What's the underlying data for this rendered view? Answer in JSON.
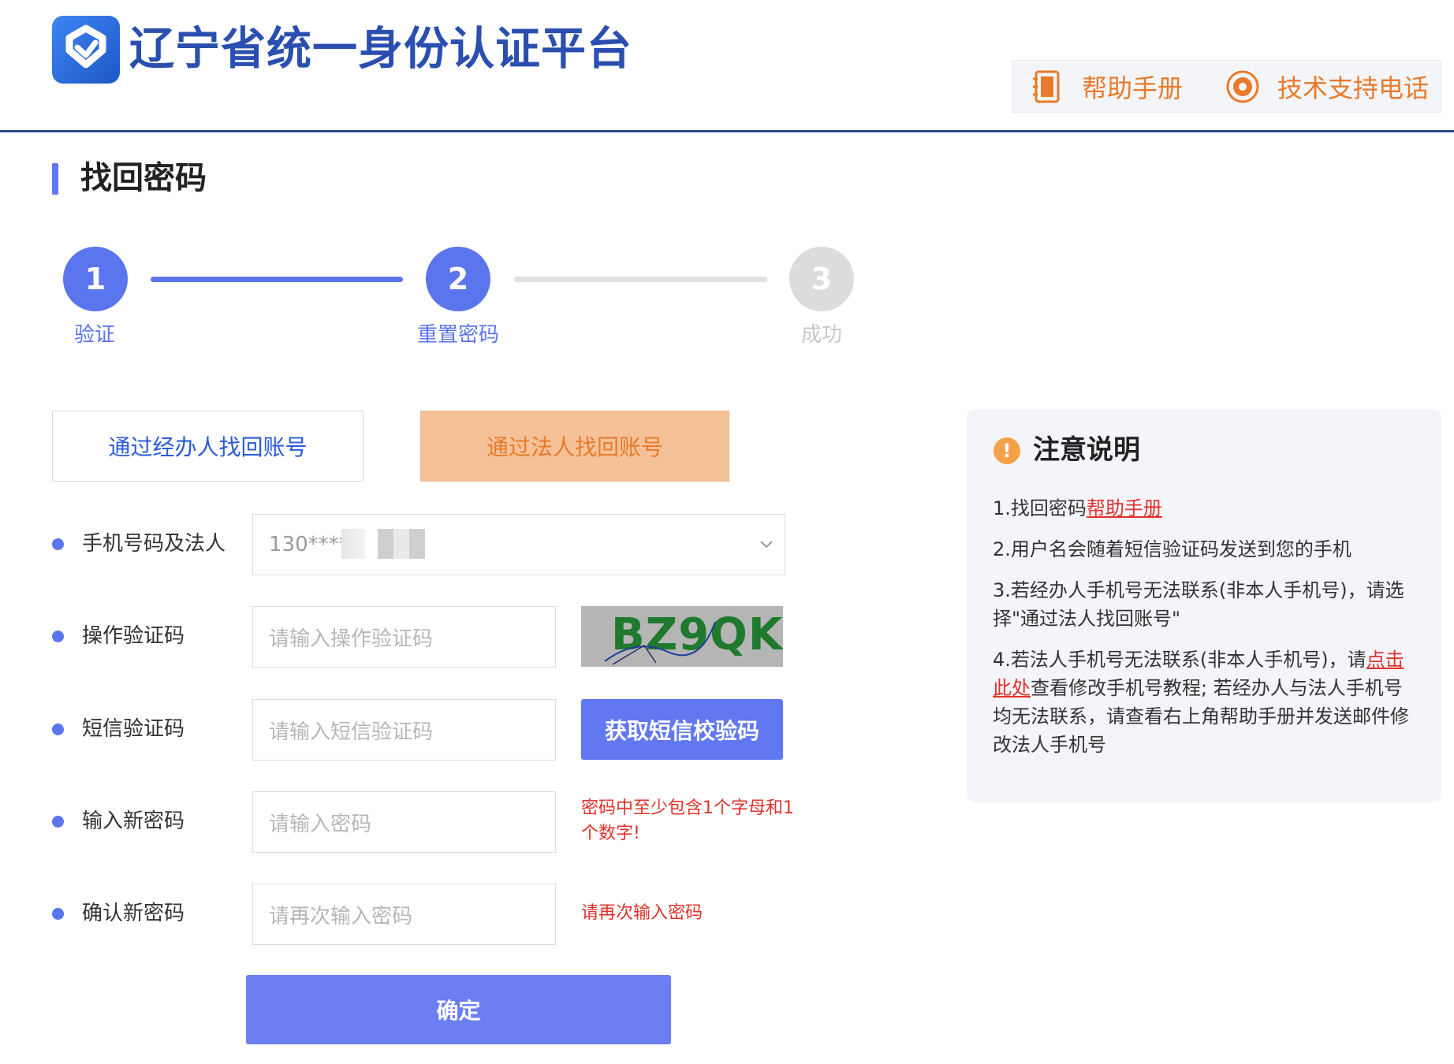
{
  "header": {
    "site_title": "辽宁省统一身份认证平台",
    "help_manual": "帮助手册",
    "support_phone": "技术支持电话",
    "accent": "#2a4fb0",
    "help_color": "#e87a2a"
  },
  "page": {
    "section_title": "找回密码"
  },
  "steps": [
    {
      "number": "1",
      "label": "验证",
      "state": "done"
    },
    {
      "number": "2",
      "label": "重置密码",
      "state": "active"
    },
    {
      "number": "3",
      "label": "成功",
      "state": "todo"
    }
  ],
  "tabs": {
    "agent": "通过经办人找回账号",
    "legal": "通过法人找回账号"
  },
  "form": {
    "phone_label": "手机号码及法人",
    "phone_value": "130****",
    "op_code_label": "操作验证码",
    "op_code_placeholder": "请输入操作验证码",
    "captcha_text": "BZ9QK",
    "sms_label": "短信验证码",
    "sms_placeholder": "请输入短信验证码",
    "sms_button": "获取短信校验码",
    "new_pwd_label": "输入新密码",
    "new_pwd_placeholder": "请输入密码",
    "new_pwd_hint": "密码中至少包含1个字母和1个数字!",
    "confirm_pwd_label": "确认新密码",
    "confirm_pwd_placeholder": "请再次输入密码",
    "confirm_pwd_hint": "请再次输入密码",
    "submit": "确定"
  },
  "notice": {
    "title": "注意说明",
    "item1_prefix": "1.找回密码",
    "item1_link": "帮助手册",
    "item2": "2.用户名会随着短信验证码发送到您的手机",
    "item3": "3.若经办人手机号无法联系(非本人手机号)，请选择\"通过法人找回账号\"",
    "item4_prefix": "4.若法人手机号无法联系(非本人手机号)，请",
    "item4_link": "点击此处",
    "item4_suffix": "查看修改手机号教程; 若经办人与法人手机号均无法联系，请查看右上角帮助手册并发送邮件修改法人手机号"
  },
  "colors": {
    "primary": "#5b75ee",
    "warning": "#e0322b",
    "tab_active_bg": "#f5c199"
  }
}
